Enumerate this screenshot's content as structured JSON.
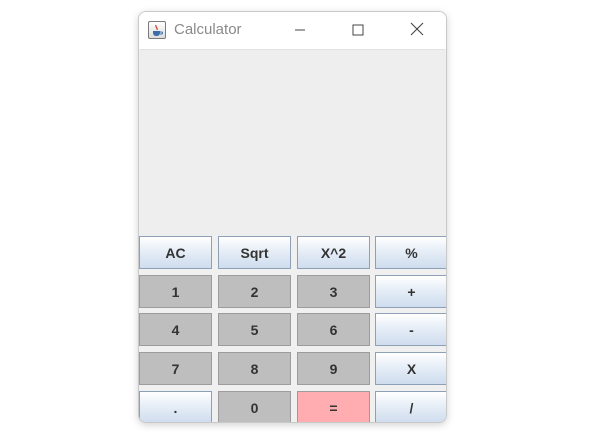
{
  "window": {
    "title": "Calculator"
  },
  "display": {
    "value": ""
  },
  "buttons": {
    "ac": "AC",
    "sqrt": "Sqrt",
    "square": "X^2",
    "percent": "%",
    "one": "1",
    "two": "2",
    "three": "3",
    "plus": "+",
    "four": "4",
    "five": "5",
    "six": "6",
    "minus": "-",
    "seven": "7",
    "eight": "8",
    "nine": "9",
    "multiply": "X",
    "dot": ".",
    "zero": "0",
    "equals": "=",
    "divide": "/"
  },
  "icons": {
    "app": "java-cup-icon",
    "minimize": "minimize-icon",
    "maximize": "maximize-icon",
    "close": "close-icon"
  },
  "colors": {
    "operator_button": "#dce6f2",
    "digit_button": "#bebebe",
    "equals_button": "#ffadb0",
    "display_background": "#eeeeee"
  }
}
